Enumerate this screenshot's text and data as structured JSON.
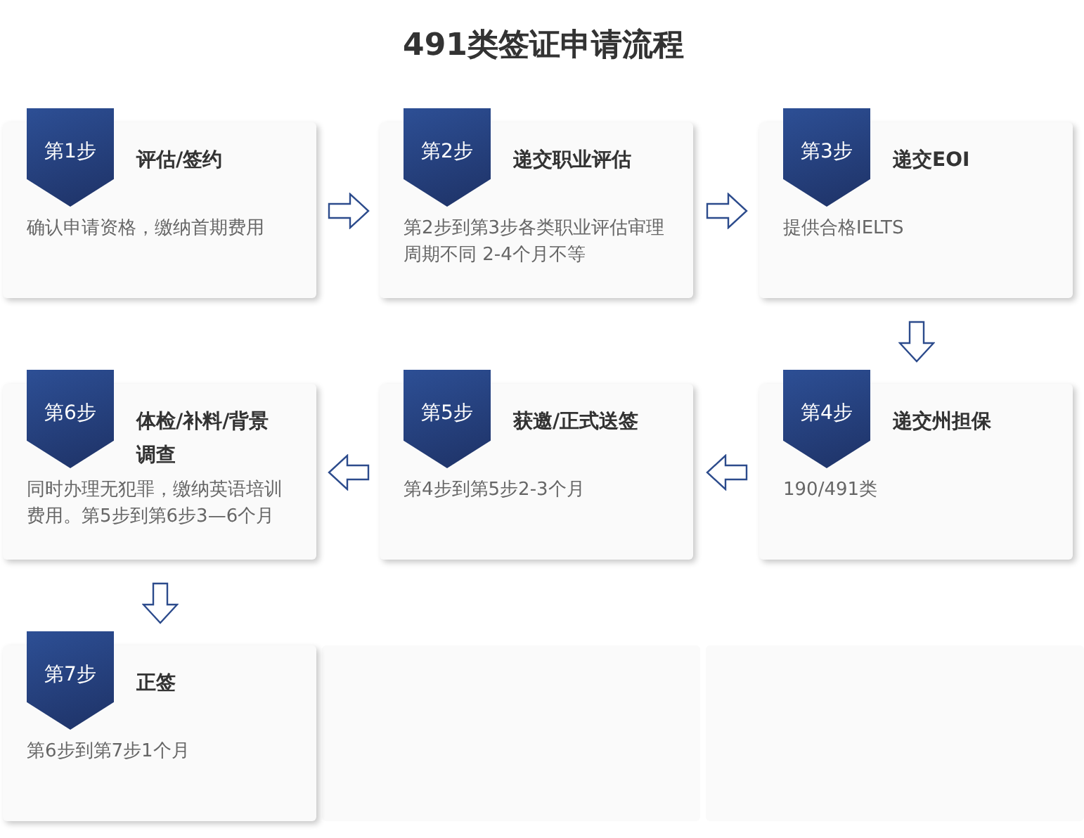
{
  "title": "491类签证申请流程",
  "rows": [
    {
      "cells": [
        {
          "kind": "step",
          "badge": "第1步",
          "title": "评估/签约",
          "desc": "确认申请资格，缴纳首期费用"
        },
        {
          "kind": "right"
        },
        {
          "kind": "step",
          "badge": "第2步",
          "title": "递交职业评估",
          "desc": "第2步到第3步各类职业评估审理周期不同 2-4个月不等"
        },
        {
          "kind": "right"
        },
        {
          "kind": "step",
          "badge": "第3步",
          "title": "递交EOI",
          "desc": "提供合格IELTS"
        }
      ]
    },
    {
      "cells": [
        {
          "kind": "blank"
        },
        {
          "kind": "blank"
        },
        {
          "kind": "blank"
        },
        {
          "kind": "blank"
        },
        {
          "kind": "down"
        }
      ]
    },
    {
      "cells": [
        {
          "kind": "step",
          "badge": "第6步",
          "title": "体检/补料/背景调查",
          "desc": "同时办理无犯罪，缴纳英语培训费用。第5步到第6步3—6个月"
        },
        {
          "kind": "left"
        },
        {
          "kind": "step",
          "badge": "第5步",
          "title": "获邀/正式送签",
          "desc": "第4步到第5步2-3个月"
        },
        {
          "kind": "left"
        },
        {
          "kind": "step",
          "badge": "第4步",
          "title": "递交州担保",
          "desc": "190/491类"
        }
      ]
    },
    {
      "cells": [
        {
          "kind": "down"
        },
        {
          "kind": "blank"
        },
        {
          "kind": "blank"
        },
        {
          "kind": "blank"
        },
        {
          "kind": "blank"
        }
      ]
    },
    {
      "cells": [
        {
          "kind": "step",
          "badge": "第7步",
          "title": "正签",
          "desc": "第6步到第7步1个月"
        },
        {
          "kind": "panel"
        },
        {
          "kind": "panel"
        }
      ]
    }
  ]
}
